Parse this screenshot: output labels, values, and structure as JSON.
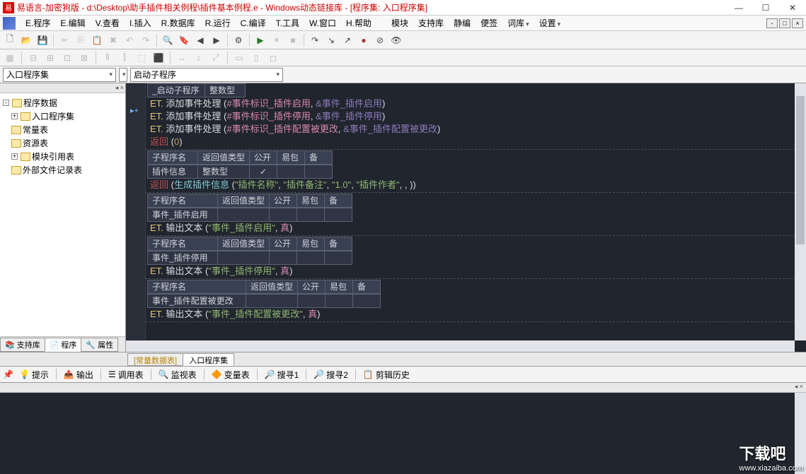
{
  "title": "易语言-加密狗版 - d:\\Desktop\\助手插件相关例程\\插件基本例程.e - Windows动态链接库 - [程序集: 入口程序集]",
  "menu": {
    "file": "E.程序",
    "edit": "E.编辑",
    "find": "V.查看",
    "insert": "I.插入",
    "db": "R.数据库",
    "run": "R.运行",
    "compile": "C.编译",
    "tool": "T.工具",
    "window": "W.窗口",
    "help": "H.帮助",
    "module": "模块",
    "support": "支持库",
    "mute": "静编",
    "note": "便签",
    "dict": "词库",
    "setting": "设置"
  },
  "combo": {
    "progset": "入口程序集",
    "startsub": "启动子程序"
  },
  "tree": {
    "root": "程序数据",
    "n1": "入口程序集",
    "n2": "常量表",
    "n3": "资源表",
    "n4": "模块引用表",
    "n5": "外部文件记录表"
  },
  "hdr": {
    "sub": "子程序名",
    "ret": "返回值类型",
    "pub": "公开",
    "pkg": "易包",
    "rem": "备 注"
  },
  "startsub": "_启动子程序",
  "inttype": "整数型",
  "code": {
    "et": "ET.",
    "add": "添加事件处理",
    "ret": "返回",
    "p1a": "#事件标识_插件启用",
    "p1b": "&事件_插件启用",
    "p2a": "#事件标识_插件停用",
    "p2b": "&事件_插件停用",
    "p3a": "#事件标识_插件配置被更改",
    "p3b": "&事件_插件配置被更改",
    "zero": "0",
    "plugininfo": "插件信息",
    "gen": "生成插件信息",
    "s1": "\"插件名称\"",
    "s2": "\"插件备注\"",
    "s3": "\"1.0\"",
    "s4": "\"插件作者\"",
    "ev1": "事件_插件启用",
    "ev2": "事件_插件停用",
    "ev3": "事件_插件配置被更改",
    "out": "输出文本",
    "t1": "\"事件_插件启用\"",
    "t2": "\"事件_插件停用\"",
    "t3": "\"事件_插件配置被更改\"",
    "true": "真"
  },
  "sidetabs": {
    "support": "支持库",
    "program": "程序",
    "property": "属性"
  },
  "edtabs": {
    "const": "[常量数据表]",
    "main": "入口程序集"
  },
  "outtabs": {
    "tip": "提示",
    "output": "输出",
    "call": "调用表",
    "watch": "监视表",
    "var": "变量表",
    "find1": "搜寻1",
    "find2": "搜寻2",
    "clip": "剪辑历史"
  },
  "wm": {
    "big": "下载吧",
    "url": "www.xiazaiba.com"
  }
}
